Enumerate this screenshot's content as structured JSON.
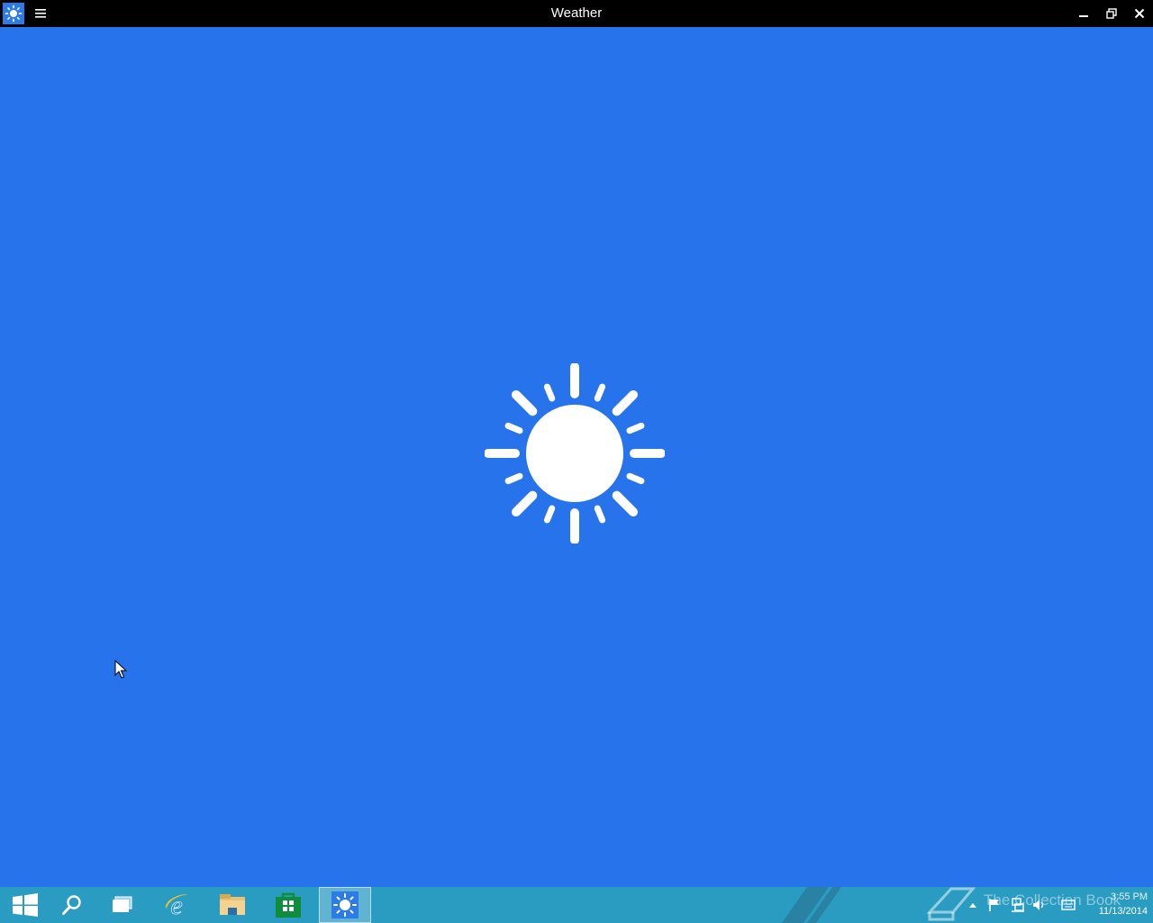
{
  "window": {
    "title": "Weather",
    "app_icon": "weather-sun-icon",
    "menu_icon": "hamburger-menu-icon",
    "controls": [
      "minimize-icon",
      "restore-icon",
      "close-icon"
    ]
  },
  "splash": {
    "icon": "sun-icon",
    "background": "#2673ec"
  },
  "taskbar": {
    "background": "#2a9cc2",
    "items": [
      {
        "name": "start",
        "icon": "windows-logo-icon"
      },
      {
        "name": "search",
        "icon": "search-icon"
      },
      {
        "name": "task-view",
        "icon": "task-view-icon"
      },
      {
        "name": "internet-explorer",
        "icon": "internet-explorer-icon"
      },
      {
        "name": "file-explorer",
        "icon": "folder-icon"
      },
      {
        "name": "store",
        "icon": "store-bag-icon"
      },
      {
        "name": "weather",
        "icon": "weather-sun-icon",
        "active": true
      }
    ],
    "watermark": "The Collection Book",
    "tray_icons": [
      "show-hidden-icons-chevron",
      "action-center-flag-icon",
      "network-icon",
      "volume-icon",
      "keyboard-icon"
    ],
    "clock": {
      "time": "3:55 PM",
      "date": "11/13/2014"
    }
  }
}
